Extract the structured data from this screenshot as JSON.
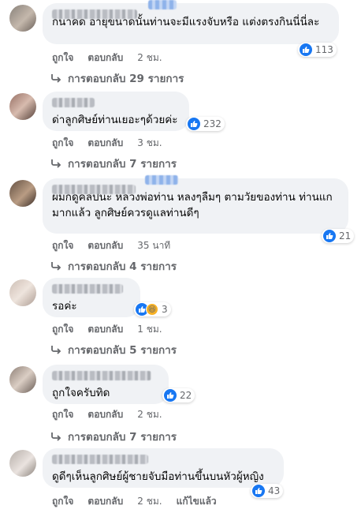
{
  "comments": [
    {
      "text": "ก็น่าคิด อายุขนาดนั้นท่านจะมีแรงจับหรือ แต่งตรงกินนี่นี่ละ",
      "reaction_count": "113",
      "like_label": "ถูกใจ",
      "reply_label": "ตอบกลับ",
      "time": "2 ชม.",
      "replies_label": "การตอบกลับ 29 รายการ"
    },
    {
      "text": "ด่าลูกศิษย์ท่านเยอะๆด้วยค่ะ",
      "reaction_count": "232",
      "like_label": "ถูกใจ",
      "reply_label": "ตอบกลับ",
      "time": "3 ชม.",
      "replies_label": "การตอบกลับ 7 รายการ"
    },
    {
      "text": "ผมก็ดูคลิปนะ หลวงพ่อท่าน หลงๆลืมๆ ตามวัยของท่าน ท่านแก มากแล้ว ลูกศิษย์ควรดูแลท่านดีๆ",
      "reaction_count": "21",
      "like_label": "ถูกใจ",
      "reply_label": "ตอบกลับ",
      "time": "35 นาที",
      "replies_label": "การตอบกลับ 4 รายการ"
    },
    {
      "text": "รอค่ะ",
      "reaction_count": "3",
      "like_label": "ถูกใจ",
      "reply_label": "ตอบกลับ",
      "time": "1 ชม.",
      "replies_label": "การตอบกลับ 5 รายการ"
    },
    {
      "text": "ถูกใจครับทิด",
      "reaction_count": "22",
      "like_label": "ถูกใจ",
      "reply_label": "ตอบกลับ",
      "time": "2 ชม.",
      "replies_label": "การตอบกลับ 7 รายการ"
    },
    {
      "text": "ดูดีๆเห็นลูกศิษย์ผู้ชายจับมือท่านขึ้นบนหัวผู้หญิง",
      "reaction_count": "43",
      "like_label": "ถูกใจ",
      "reply_label": "ตอบกลับ",
      "time": "2 ชม.",
      "edited_label": "แก้ไขแล้ว"
    }
  ],
  "icons": {
    "like": "thumbs-up-icon",
    "haha": "laugh-icon",
    "reply_arrow": "reply-arrow-icon"
  },
  "colors": {
    "like_blue": "#1877f2",
    "bubble_gray": "#f0f2f5",
    "meta_gray": "#65676b"
  }
}
